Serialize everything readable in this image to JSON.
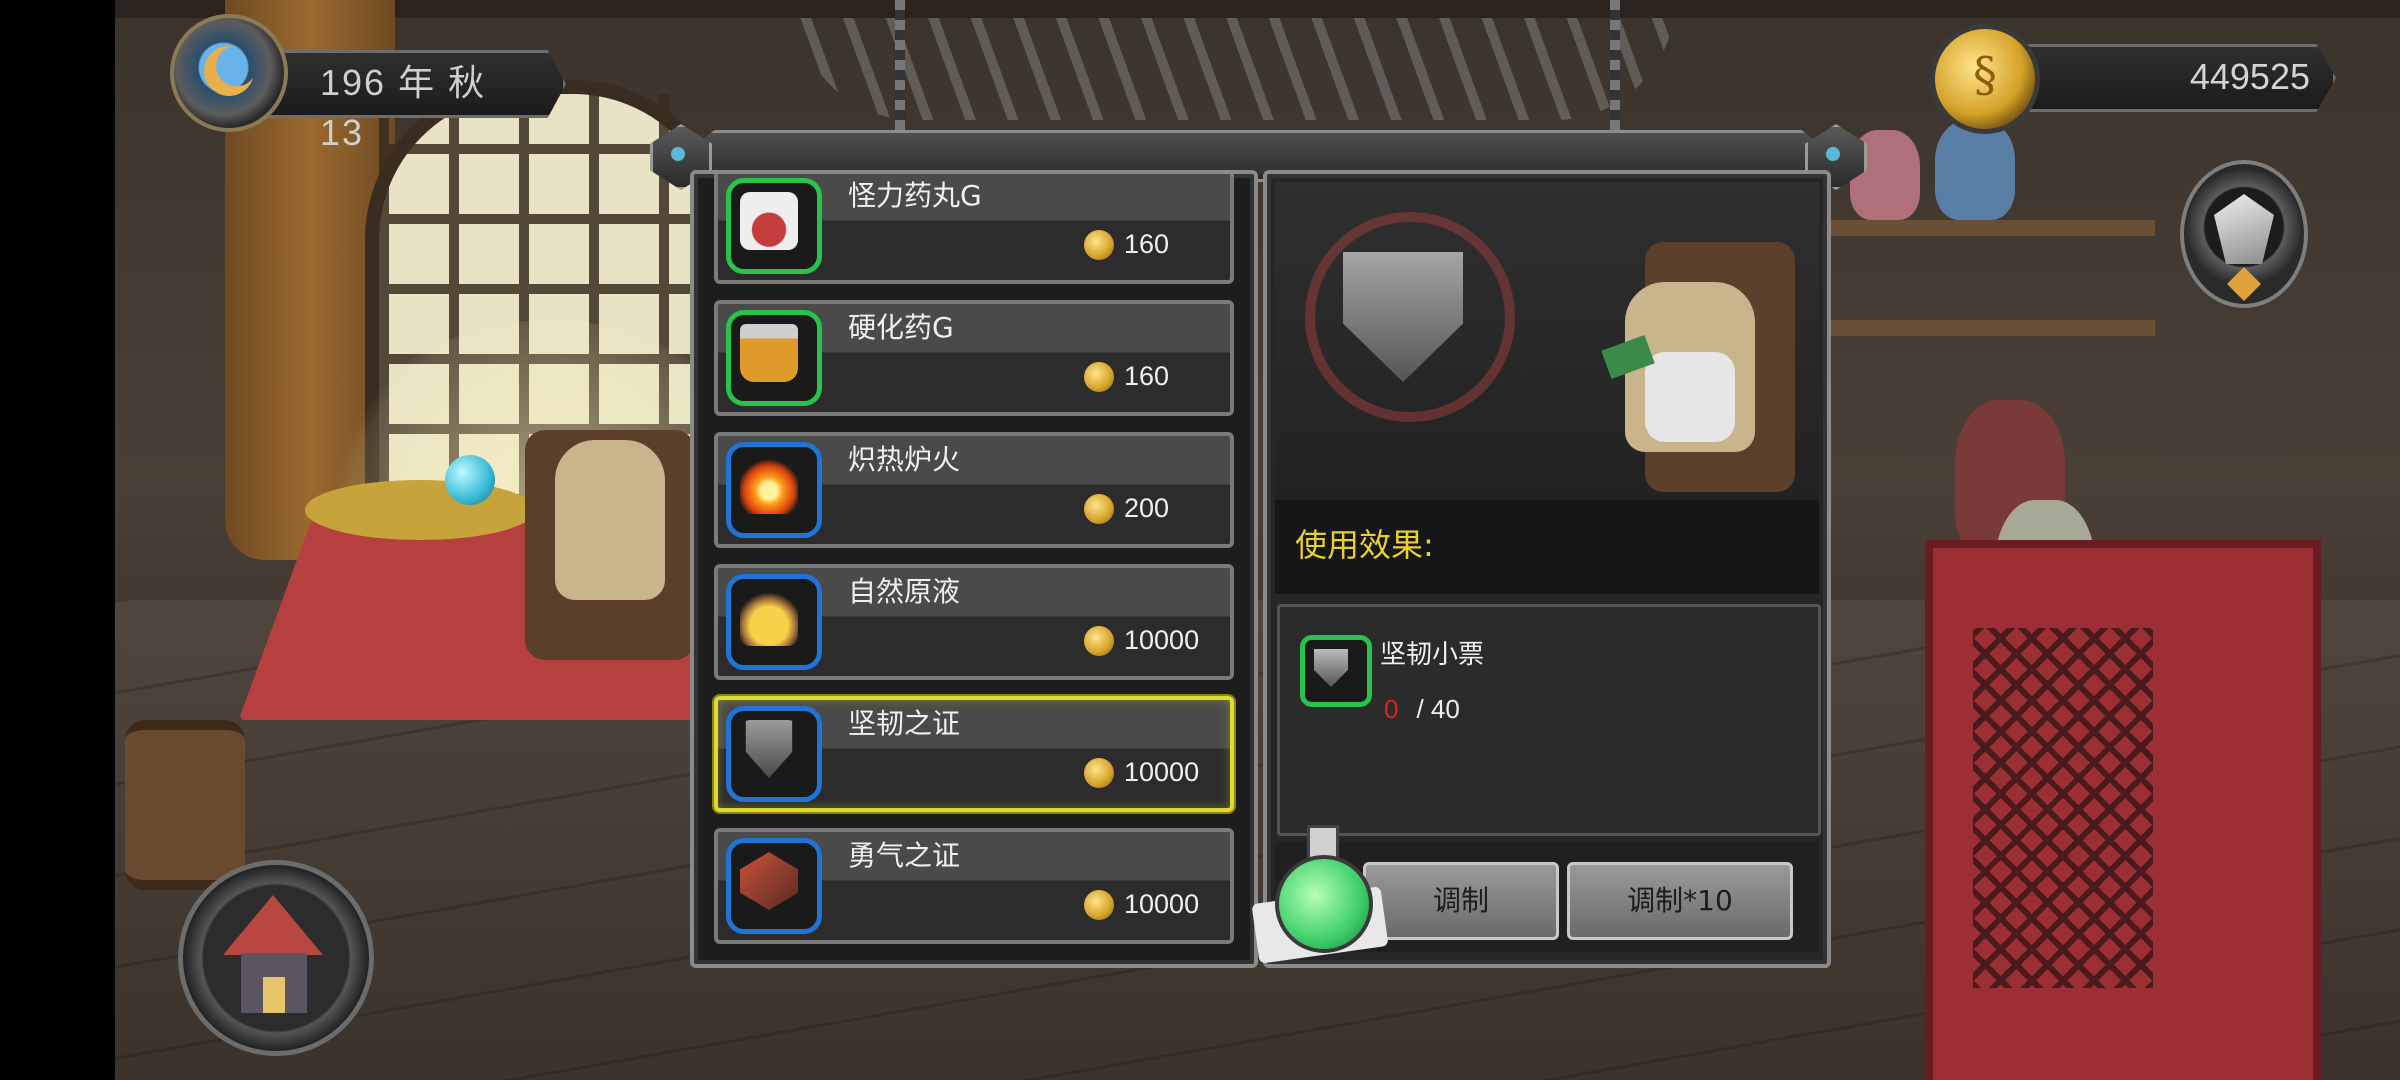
{
  "hud": {
    "date": "196 年 秋 13",
    "coins": "449525"
  },
  "items": [
    {
      "name": "怪力药丸G",
      "price": "160",
      "frame": "green",
      "icon": "pill-bag-icon"
    },
    {
      "name": "硬化药G",
      "price": "160",
      "frame": "green",
      "icon": "hardening-jar-icon"
    },
    {
      "name": "炽热炉火",
      "price": "200",
      "frame": "blue",
      "icon": "fire-icon"
    },
    {
      "name": "自然原液",
      "price": "10000",
      "frame": "blue",
      "icon": "flask-icon"
    },
    {
      "name": "坚韧之证",
      "price": "10000",
      "frame": "blue",
      "icon": "shield-emblem-icon",
      "selected": true
    },
    {
      "name": "勇气之证",
      "price": "10000",
      "frame": "blue",
      "icon": "courage-emblem-icon"
    }
  ],
  "detail": {
    "effect_label": "使用效果:",
    "material": {
      "name": "坚韧小票",
      "have": "0",
      "need": "/ 40"
    },
    "buttons": {
      "craft": "调制",
      "craft10": "调制*10"
    }
  },
  "colors": {
    "selected_border": "#dfdc2f",
    "frame_green": "#29c24a",
    "frame_blue": "#1f74d6",
    "effect_text": "#e8d030",
    "missing_count": "#e02020"
  }
}
